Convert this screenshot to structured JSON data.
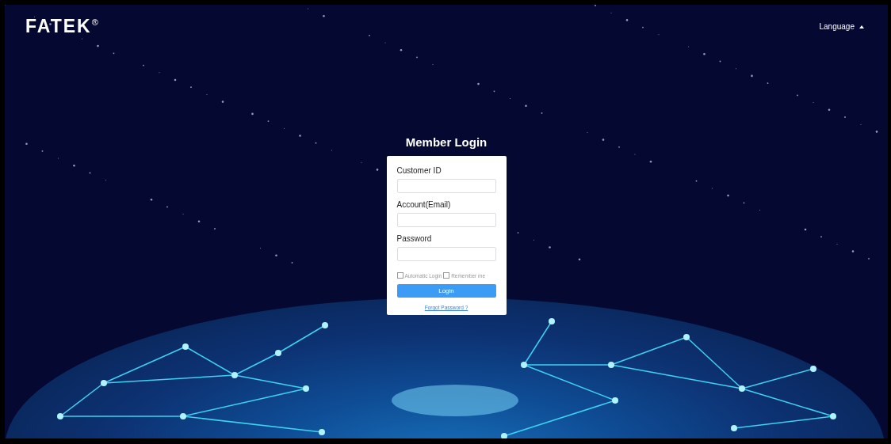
{
  "brand": {
    "logo": "FATEK$^{®}$"
  },
  "language_menu": {
    "label": "Language",
    "expanded": true
  },
  "login": {
    "title": "Member Login",
    "fields": [
      {
        "label": "Customer ID"
      },
      {
        "label": "Account(Email)"
      },
      {
        "label": "Password"
      }
    ],
    "options": [
      {
        "label": "Automatic Login",
        "checked": false
      },
      {
        "label": "Remember me",
        "checked": false
      }
    ],
    "submit": "Login",
    "forgot_link": "Forgot Password ?"
  }
}
